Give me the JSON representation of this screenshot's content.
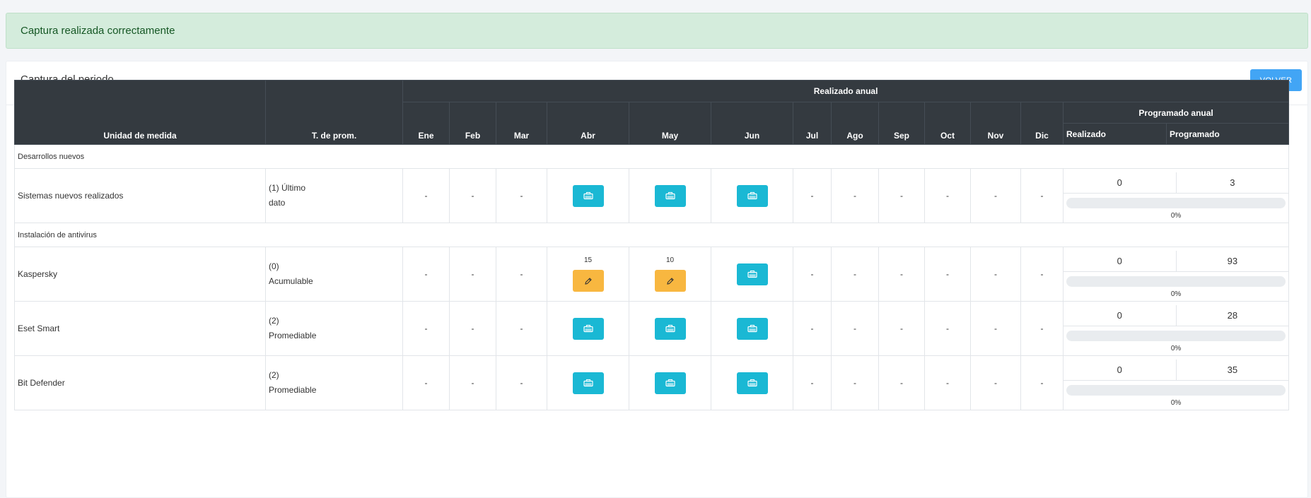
{
  "alert": {
    "message": "Captura realizada correctamente"
  },
  "card": {
    "title": "Captura del periodo",
    "back_label": "VOLVER"
  },
  "table": {
    "headers": {
      "unit": "Unidad de medida",
      "tprom": "T. de prom.",
      "realizado_anual": "Realizado anual",
      "programado_anual": "Programado anual",
      "months": [
        "Ene",
        "Feb",
        "Mar",
        "Abr",
        "May",
        "Jun",
        "Jul",
        "Ago",
        "Sep",
        "Oct",
        "Nov",
        "Dic"
      ],
      "realizado": "Realizado",
      "programado": "Programado"
    },
    "sections": [
      {
        "title": "Desarrollos nuevos",
        "rows": [
          {
            "name": "Sistemas nuevos realizados",
            "tprom_line1": "(1) Último",
            "tprom_line2": "dato",
            "cells": [
              "-",
              "-",
              "-",
              {
                "icon": "camera-icon"
              },
              {
                "icon": "camera-icon"
              },
              {
                "icon": "camera-icon"
              },
              "-",
              "-",
              "-",
              "-",
              "-",
              "-"
            ],
            "realizado": "0",
            "programado": "3",
            "progress_percent": 0,
            "progress_label": "0%"
          }
        ]
      },
      {
        "title": "Instalación de antivirus",
        "rows": [
          {
            "name": "Kaspersky",
            "tprom_line1": "(0)",
            "tprom_line2": "Acumulable",
            "cells": [
              "-",
              "-",
              "-",
              {
                "value": "15",
                "icon": "pencil-icon"
              },
              {
                "value": "10",
                "icon": "pencil-icon"
              },
              {
                "icon": "camera-icon"
              },
              "-",
              "-",
              "-",
              "-",
              "-",
              "-"
            ],
            "realizado": "0",
            "programado": "93",
            "progress_percent": 0,
            "progress_label": "0%"
          },
          {
            "name": "Eset Smart",
            "tprom_line1": "(2)",
            "tprom_line2": "Promediable",
            "cells": [
              "-",
              "-",
              "-",
              {
                "icon": "camera-icon"
              },
              {
                "icon": "camera-icon"
              },
              {
                "icon": "camera-icon"
              },
              "-",
              "-",
              "-",
              "-",
              "-",
              "-"
            ],
            "realizado": "0",
            "programado": "28",
            "progress_percent": 0,
            "progress_label": "0%"
          },
          {
            "name": "Bit Defender",
            "tprom_line1": "(2)",
            "tprom_line2": "Promediable",
            "cells": [
              "-",
              "-",
              "-",
              {
                "icon": "camera-icon"
              },
              {
                "icon": "camera-icon"
              },
              {
                "icon": "camera-icon"
              },
              "-",
              "-",
              "-",
              "-",
              "-",
              "-"
            ],
            "realizado": "0",
            "programado": "35",
            "progress_percent": 0,
            "progress_label": "0%"
          }
        ]
      }
    ]
  },
  "colors": {
    "alert_bg": "#d4ecdc",
    "header_bg": "#343a40",
    "capture_button": "#1ab8d4",
    "edit_button": "#f8b740",
    "back_button": "#42a5f5"
  }
}
